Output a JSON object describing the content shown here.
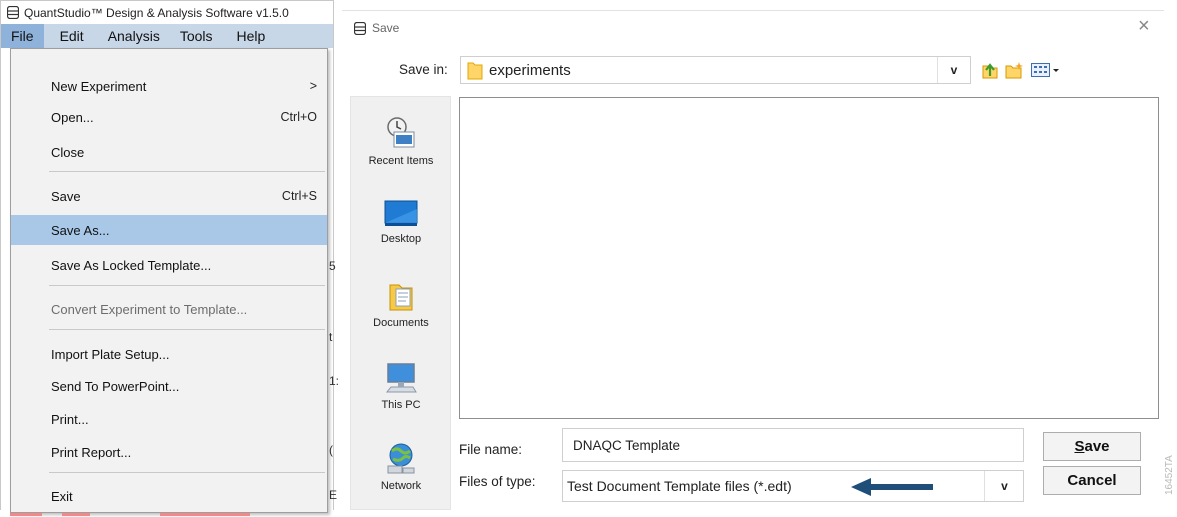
{
  "app": {
    "title": "QuantStudio™ Design & Analysis Software v1.5.0",
    "menubar": [
      {
        "label": "File",
        "active": true
      },
      {
        "label": "Edit",
        "active": false
      },
      {
        "label": "Analysis",
        "active": false
      },
      {
        "label": "Tools",
        "active": false
      },
      {
        "label": "Help",
        "active": false
      }
    ],
    "background_fragments": [
      "5",
      "t",
      "1:",
      "(",
      "E"
    ],
    "file_menu": [
      {
        "label": "New Experiment",
        "shortcut": "",
        "submenu_arrow": ">",
        "state": "normal"
      },
      {
        "label": "Open...",
        "shortcut": "Ctrl+O",
        "submenu_arrow": "",
        "state": "normal"
      },
      {
        "label": "Close",
        "shortcut": "",
        "submenu_arrow": "",
        "state": "normal"
      },
      {
        "label": "Save",
        "shortcut": "Ctrl+S",
        "submenu_arrow": "",
        "state": "normal"
      },
      {
        "label": "Save As...",
        "shortcut": "",
        "submenu_arrow": "",
        "state": "highlighted"
      },
      {
        "label": "Save As Locked Template...",
        "shortcut": "",
        "submenu_arrow": "",
        "state": "normal"
      },
      {
        "label": "Convert Experiment to Template...",
        "shortcut": "",
        "submenu_arrow": "",
        "state": "disabled"
      },
      {
        "label": "Import Plate Setup...",
        "shortcut": "",
        "submenu_arrow": "",
        "state": "normal"
      },
      {
        "label": "Send To PowerPoint...",
        "shortcut": "",
        "submenu_arrow": "",
        "state": "normal"
      },
      {
        "label": "Print...",
        "shortcut": "",
        "submenu_arrow": "",
        "state": "normal"
      },
      {
        "label": "Print Report...",
        "shortcut": "",
        "submenu_arrow": "",
        "state": "normal"
      },
      {
        "label": "Exit",
        "shortcut": "",
        "submenu_arrow": "",
        "state": "normal"
      }
    ]
  },
  "dialog": {
    "title": "Save",
    "close_glyph": "×",
    "save_in_label": "Save in:",
    "save_in_value": "experiments",
    "dropdown_glyph": "v",
    "places": [
      {
        "label": "Recent Items",
        "icon": "recent-items-icon"
      },
      {
        "label": "Desktop",
        "icon": "desktop-icon"
      },
      {
        "label": "Documents",
        "icon": "documents-icon"
      },
      {
        "label": "This PC",
        "icon": "this-pc-icon"
      },
      {
        "label": "Network",
        "icon": "network-icon"
      }
    ],
    "file_name_label": "File name:",
    "file_name_value": "DNAQC Template",
    "files_of_type_label": "Files of type:",
    "files_of_type_value": "Test Document Template files (*.edt)",
    "save_button": {
      "underlined": "S",
      "rest": "ave"
    },
    "cancel_button": "Cancel"
  },
  "figure_code": "16452TA",
  "colors": {
    "menubar_bg": "#c7d7e8",
    "active_menu_bg": "#8fb2da",
    "highlight_bg": "#a9c8e8",
    "arrow_annotation": "#1f4e79"
  }
}
